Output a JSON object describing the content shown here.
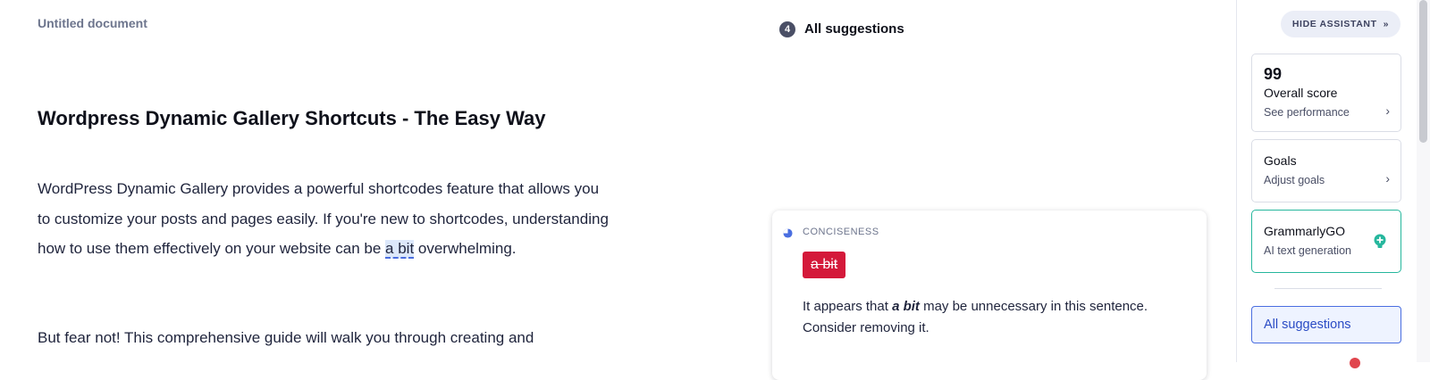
{
  "document": {
    "title": "Untitled document",
    "headline": "Wordpress Dynamic Gallery Shortcuts - The Easy Way",
    "para1_before": "WordPress Dynamic Gallery provides a powerful shortcodes feature that allows you to customize your posts and pages easily. If you're new to shortcodes, understanding how to use them effectively on your website can be ",
    "para1_highlight": "a bit",
    "para1_after": " overwhelming.",
    "para2": "But fear not! This comprehensive guide will walk you through creating and"
  },
  "suggestions": {
    "count": "4",
    "header": "All suggestions"
  },
  "card": {
    "category": "CONCISENESS",
    "chip_text": "a bit",
    "text_before": "It appears that ",
    "text_bold": "a bit",
    "text_after": " may be unnecessary in this sentence. Consider removing it."
  },
  "assistant": {
    "hide_label": "HIDE ASSISTANT",
    "score": {
      "value": "99",
      "title": "Overall score",
      "sub": "See performance"
    },
    "goals": {
      "title": "Goals",
      "sub": "Adjust goals"
    },
    "go": {
      "title": "GrammarlyGO",
      "sub": "AI text generation"
    },
    "all_suggestions": "All suggestions"
  },
  "colors": {
    "accent": "#4a6ee0",
    "chip_red": "#d4193a",
    "go_green": "#26b79d"
  },
  "icons": [
    "chevron-double-right-icon",
    "chevron-right-icon",
    "bulb-icon",
    "conciseness-icon"
  ]
}
